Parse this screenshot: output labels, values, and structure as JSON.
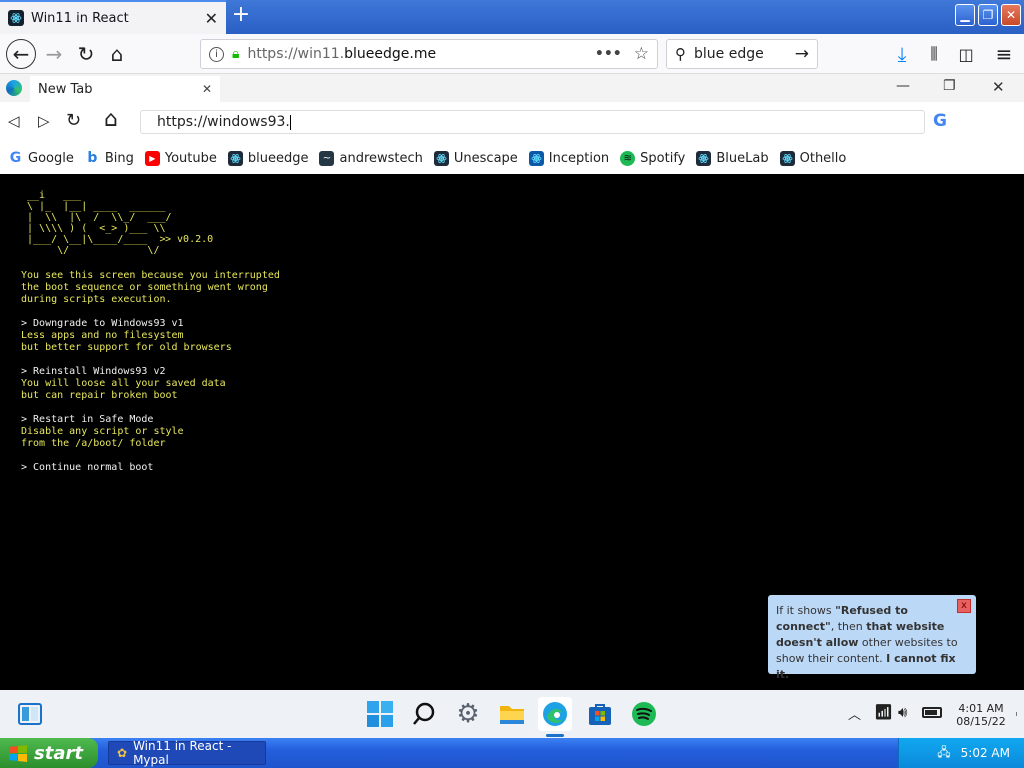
{
  "firefox": {
    "tab_title": "Win11 in React",
    "url_prefix": "https://win11.",
    "url_domain": "blueedge.me",
    "search_value": "blue edge"
  },
  "edge": {
    "tab_title": "New Tab",
    "address_value": "https://windows93."
  },
  "bookmarks": [
    {
      "label": "Google",
      "icon": "google-icon",
      "color": "#4285f4"
    },
    {
      "label": "Bing",
      "icon": "bing-icon",
      "color": "#2a7de1"
    },
    {
      "label": "Youtube",
      "icon": "youtube-icon",
      "color": "#ff0000"
    },
    {
      "label": "blueedge",
      "icon": "react-icon",
      "color": "#1e2b3a"
    },
    {
      "label": "andrewstech",
      "icon": "andrewstech-icon",
      "color": "#243745"
    },
    {
      "label": "Unescape",
      "icon": "react-icon",
      "color": "#1e2b3a"
    },
    {
      "label": "Inception",
      "icon": "inception-icon",
      "color": "#0b5aa8"
    },
    {
      "label": "Spotify",
      "icon": "spotify-icon",
      "color": "#1db954"
    },
    {
      "label": "BlueLab",
      "icon": "react-icon",
      "color": "#1e2b3a"
    },
    {
      "label": "Othello",
      "icon": "react-icon",
      "color": "#1e2b3a"
    }
  ],
  "terminal": {
    "version": "> v0.2.0",
    "intro": [
      "You see this screen because you interrupted",
      "the boot sequence or something went wrong",
      "during scripts execution."
    ],
    "options": [
      {
        "title": "> Downgrade to Windows93 v1",
        "desc": [
          "Less apps and no filesystem",
          "but better support for old browsers"
        ]
      },
      {
        "title": "> Reinstall Windows93 v2",
        "desc": [
          "You will loose all your saved data",
          "but can repair broken boot"
        ]
      },
      {
        "title": "> Restart in Safe Mode",
        "desc": [
          "Disable any script or style",
          "from the /a/boot/ folder"
        ]
      },
      {
        "title": "> Continue normal boot",
        "desc": []
      }
    ]
  },
  "notice": {
    "p1": "If it shows ",
    "p2": "\"Refused to connect\"",
    "p3": ", then ",
    "p4": "that website doesn't allow",
    "p5": " other websites to show their content. ",
    "p6": "I cannot fix it.",
    "close": "x"
  },
  "w11_taskbar": {
    "time": "4:01 AM",
    "date": "08/15/22"
  },
  "xp_taskbar": {
    "start_label": "start",
    "task_label": "Win11 in React - Mypal",
    "clock": "5:02 AM"
  }
}
